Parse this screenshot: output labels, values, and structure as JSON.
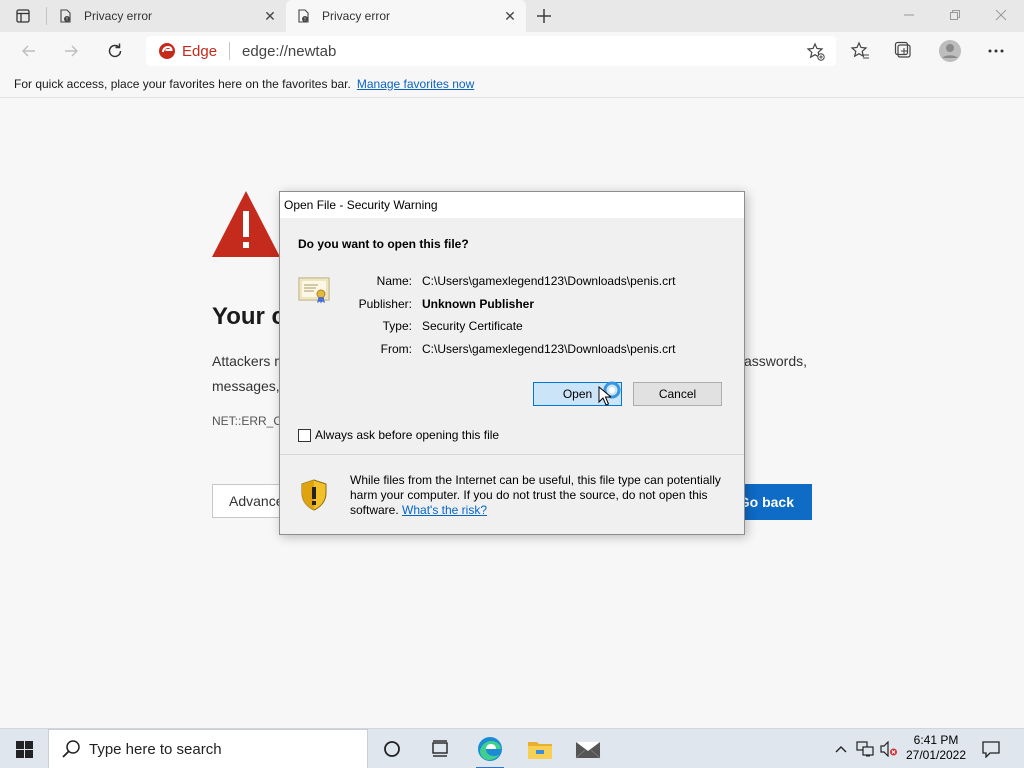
{
  "browser": {
    "tabs": [
      {
        "title": "Privacy error",
        "active": false
      },
      {
        "title": "Privacy error",
        "active": true
      }
    ],
    "address": {
      "brand": "Edge",
      "url": "edge://newtab"
    },
    "favorites_bar": {
      "message": "For quick access, place your favorites here on the favorites bar.",
      "link": "Manage favorites now"
    }
  },
  "page": {
    "heading": "Your c",
    "body_line1_start": "Attackers m",
    "body_line1_end": "asswords,",
    "body_line2_start": "messages, ",
    "error_code": "NET::ERR_C",
    "advanced_label": "Advance",
    "goback_label": "Go back"
  },
  "dialog": {
    "title": "Open File - Security Warning",
    "question": "Do you want to open this file?",
    "fields": [
      {
        "label": "Name:",
        "value": "C:\\Users\\gamexlegend123\\Downloads\\penis.crt",
        "bold": false
      },
      {
        "label": "Publisher:",
        "value": "Unknown Publisher",
        "bold": true
      },
      {
        "label": "Type:",
        "value": "Security Certificate",
        "bold": false
      },
      {
        "label": "From:",
        "value": "C:\\Users\\gamexlegend123\\Downloads\\penis.crt",
        "bold": false
      }
    ],
    "open_label": "Open",
    "cancel_label": "Cancel",
    "checkbox_label": "Always ask before opening this file",
    "checkbox_checked": false,
    "warning_text": "While files from the Internet can be useful, this file type can potentially harm your computer. If you do not trust the source, do not open this software. ",
    "risk_link": "What's the risk?"
  },
  "taskbar": {
    "search_placeholder": "Type here to search",
    "time": "6:41 PM",
    "date": "27/01/2022"
  },
  "colors": {
    "accent": "#0e6bc6",
    "error_red": "#c42b1c",
    "link": "#0066cc"
  }
}
